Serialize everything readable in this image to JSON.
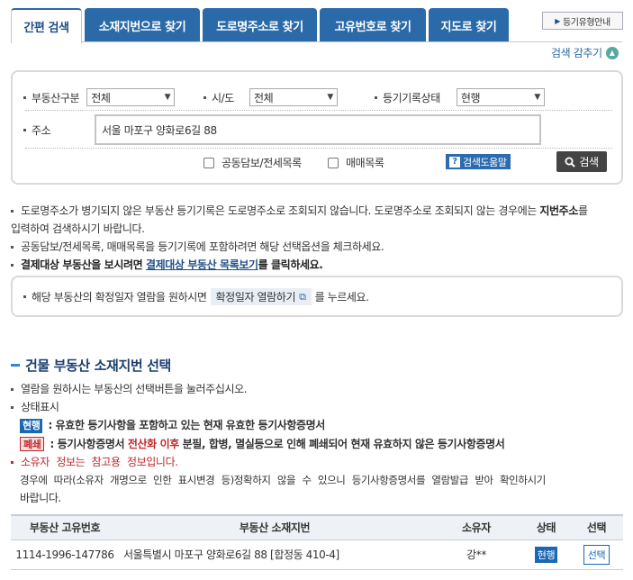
{
  "tabs": [
    {
      "label": "간편 검색"
    },
    {
      "label": "소재지번으로 찾기"
    },
    {
      "label": "도로명주소로 찾기"
    },
    {
      "label": "고유번호로 찾기"
    },
    {
      "label": "지도로 찾기"
    }
  ],
  "guide_button": "등기유형안내",
  "hide_search": "검색 감추기",
  "search": {
    "property_type_label": "부동산구분",
    "property_type_value": "전체",
    "city_label": "시/도",
    "city_value": "전체",
    "record_status_label": "등기기록상태",
    "record_status_value": "현행",
    "address_label": "주소",
    "address_value": "서울 마포구 양화로6길 88",
    "option_joint": "공동담보/전세목록",
    "option_sale": "매매목록",
    "help_label": "검색도움말",
    "search_label": "검색"
  },
  "notices": {
    "line1a": "도로명주소가 병기되지 않은 부동산 등기기록은 도로명주소로 조회되지 않습니다. 도로명주소로 조회되지 않는 경우에는 ",
    "line1b": "지번주소",
    "line1c": "를",
    "line1d": "입력하여 검색하시기 바랍니다.",
    "line2": "공동담보/전세목록, 매매목록을 등기기록에 포함하려면 해당 선택옵션을 체크하세요.",
    "line3a": "결제대상 부동산을 보시려면 ",
    "line3_link": "결제대상 부동산 목록보기",
    "line3b": "를 클릭하세요.",
    "confirm_a": "해당 부동산의 확정일자 열람을 원하시면",
    "confirm_button": "확정일자 열람하기",
    "confirm_b": "를 누르세요."
  },
  "section": {
    "title": "건물 부동산 소재지번 선택",
    "info1": "열람을 원하시는 부동산의 선택버튼을 눌러주십시오.",
    "info2": "상태표시",
    "badge_current": "현행",
    "current_desc": ": 유효한 등기사항을 포함하고 있는 현재 유효한 등기사항증명서",
    "badge_closed": "폐쇄",
    "closed_desc_a": ": 등기사항증명서 ",
    "closed_desc_red": "전산화 이후",
    "closed_desc_b": " 분필, 합병, 멸실등으로 인해 폐쇄되어 현재 유효하지 않은 등기사항증명서",
    "owner_note": "소유자 정보는 참고용 정보입니다.",
    "owner_note2": "경우에 따라(소유자 개명으로 인한 표시변경 등)정확하지 않을 수 있으니 등기사항증명서를 열람발급 받아 확인하시기",
    "owner_note3": "바랍니다."
  },
  "table": {
    "headers": [
      "부동산 고유번호",
      "부동산 소재지번",
      "소유자",
      "상태",
      "선택"
    ],
    "rows": [
      {
        "id": "1114-1996-147786",
        "address": "서울특별시 마포구 양화로6길 88 [합정동 410-4]",
        "owner": "강**",
        "status": "현행",
        "select": "선택"
      }
    ]
  }
}
